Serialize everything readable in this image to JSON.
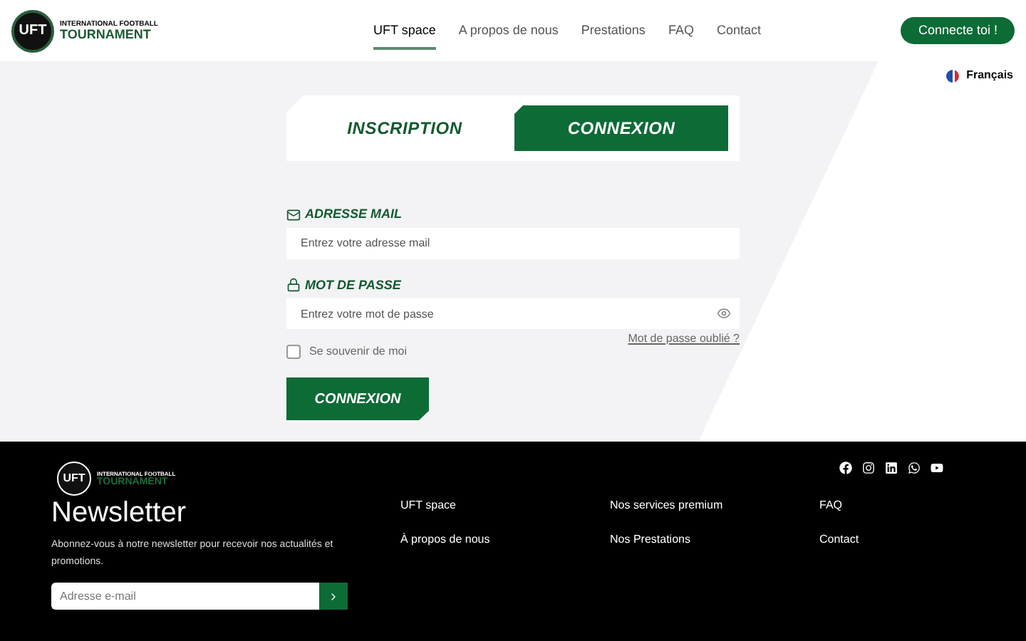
{
  "header": {
    "logo": {
      "badge": "UFT",
      "line1": "INTERNATIONAL FOOTBALL",
      "line2": "TOURNAMENT"
    },
    "nav": [
      {
        "label": "UFT space",
        "selected": true
      },
      {
        "label": "A propos de nous",
        "selected": false
      },
      {
        "label": "Prestations",
        "selected": false
      },
      {
        "label": "FAQ",
        "selected": false
      },
      {
        "label": "Contact",
        "selected": false
      }
    ],
    "cta": "Connecte toi !"
  },
  "language": "Français",
  "tabs": [
    {
      "label": "INSCRIPTION",
      "selected": false
    },
    {
      "label": "CONNEXION",
      "selected": true
    }
  ],
  "form": {
    "email": {
      "label": "ADRESSE MAIL",
      "placeholder": "Entrez votre adresse mail"
    },
    "password": {
      "label": "MOT DE PASSE",
      "placeholder": "Entrez votre mot de passe"
    },
    "forgot": "Mot de passe oublié ?",
    "remember": {
      "label": "Se souvenir de moi",
      "checked": false
    },
    "submit": "CONNEXION"
  },
  "footer": {
    "logo": {
      "badge": "UFT",
      "line1": "INTERNATIONAL FOOTBALL",
      "line2": "TOURNAMENT"
    },
    "title": "Newsletter",
    "text": "Abonnez-vous à notre newsletter pour recevoir nos actualités et promotions.",
    "newsletter_placeholder": "Adresse e-mail",
    "link_columns": [
      [
        "UFT space",
        "À propos de nous"
      ],
      [
        "Nos services premium",
        "Nos Prestations"
      ],
      [
        "FAQ",
        "Contact"
      ]
    ]
  }
}
